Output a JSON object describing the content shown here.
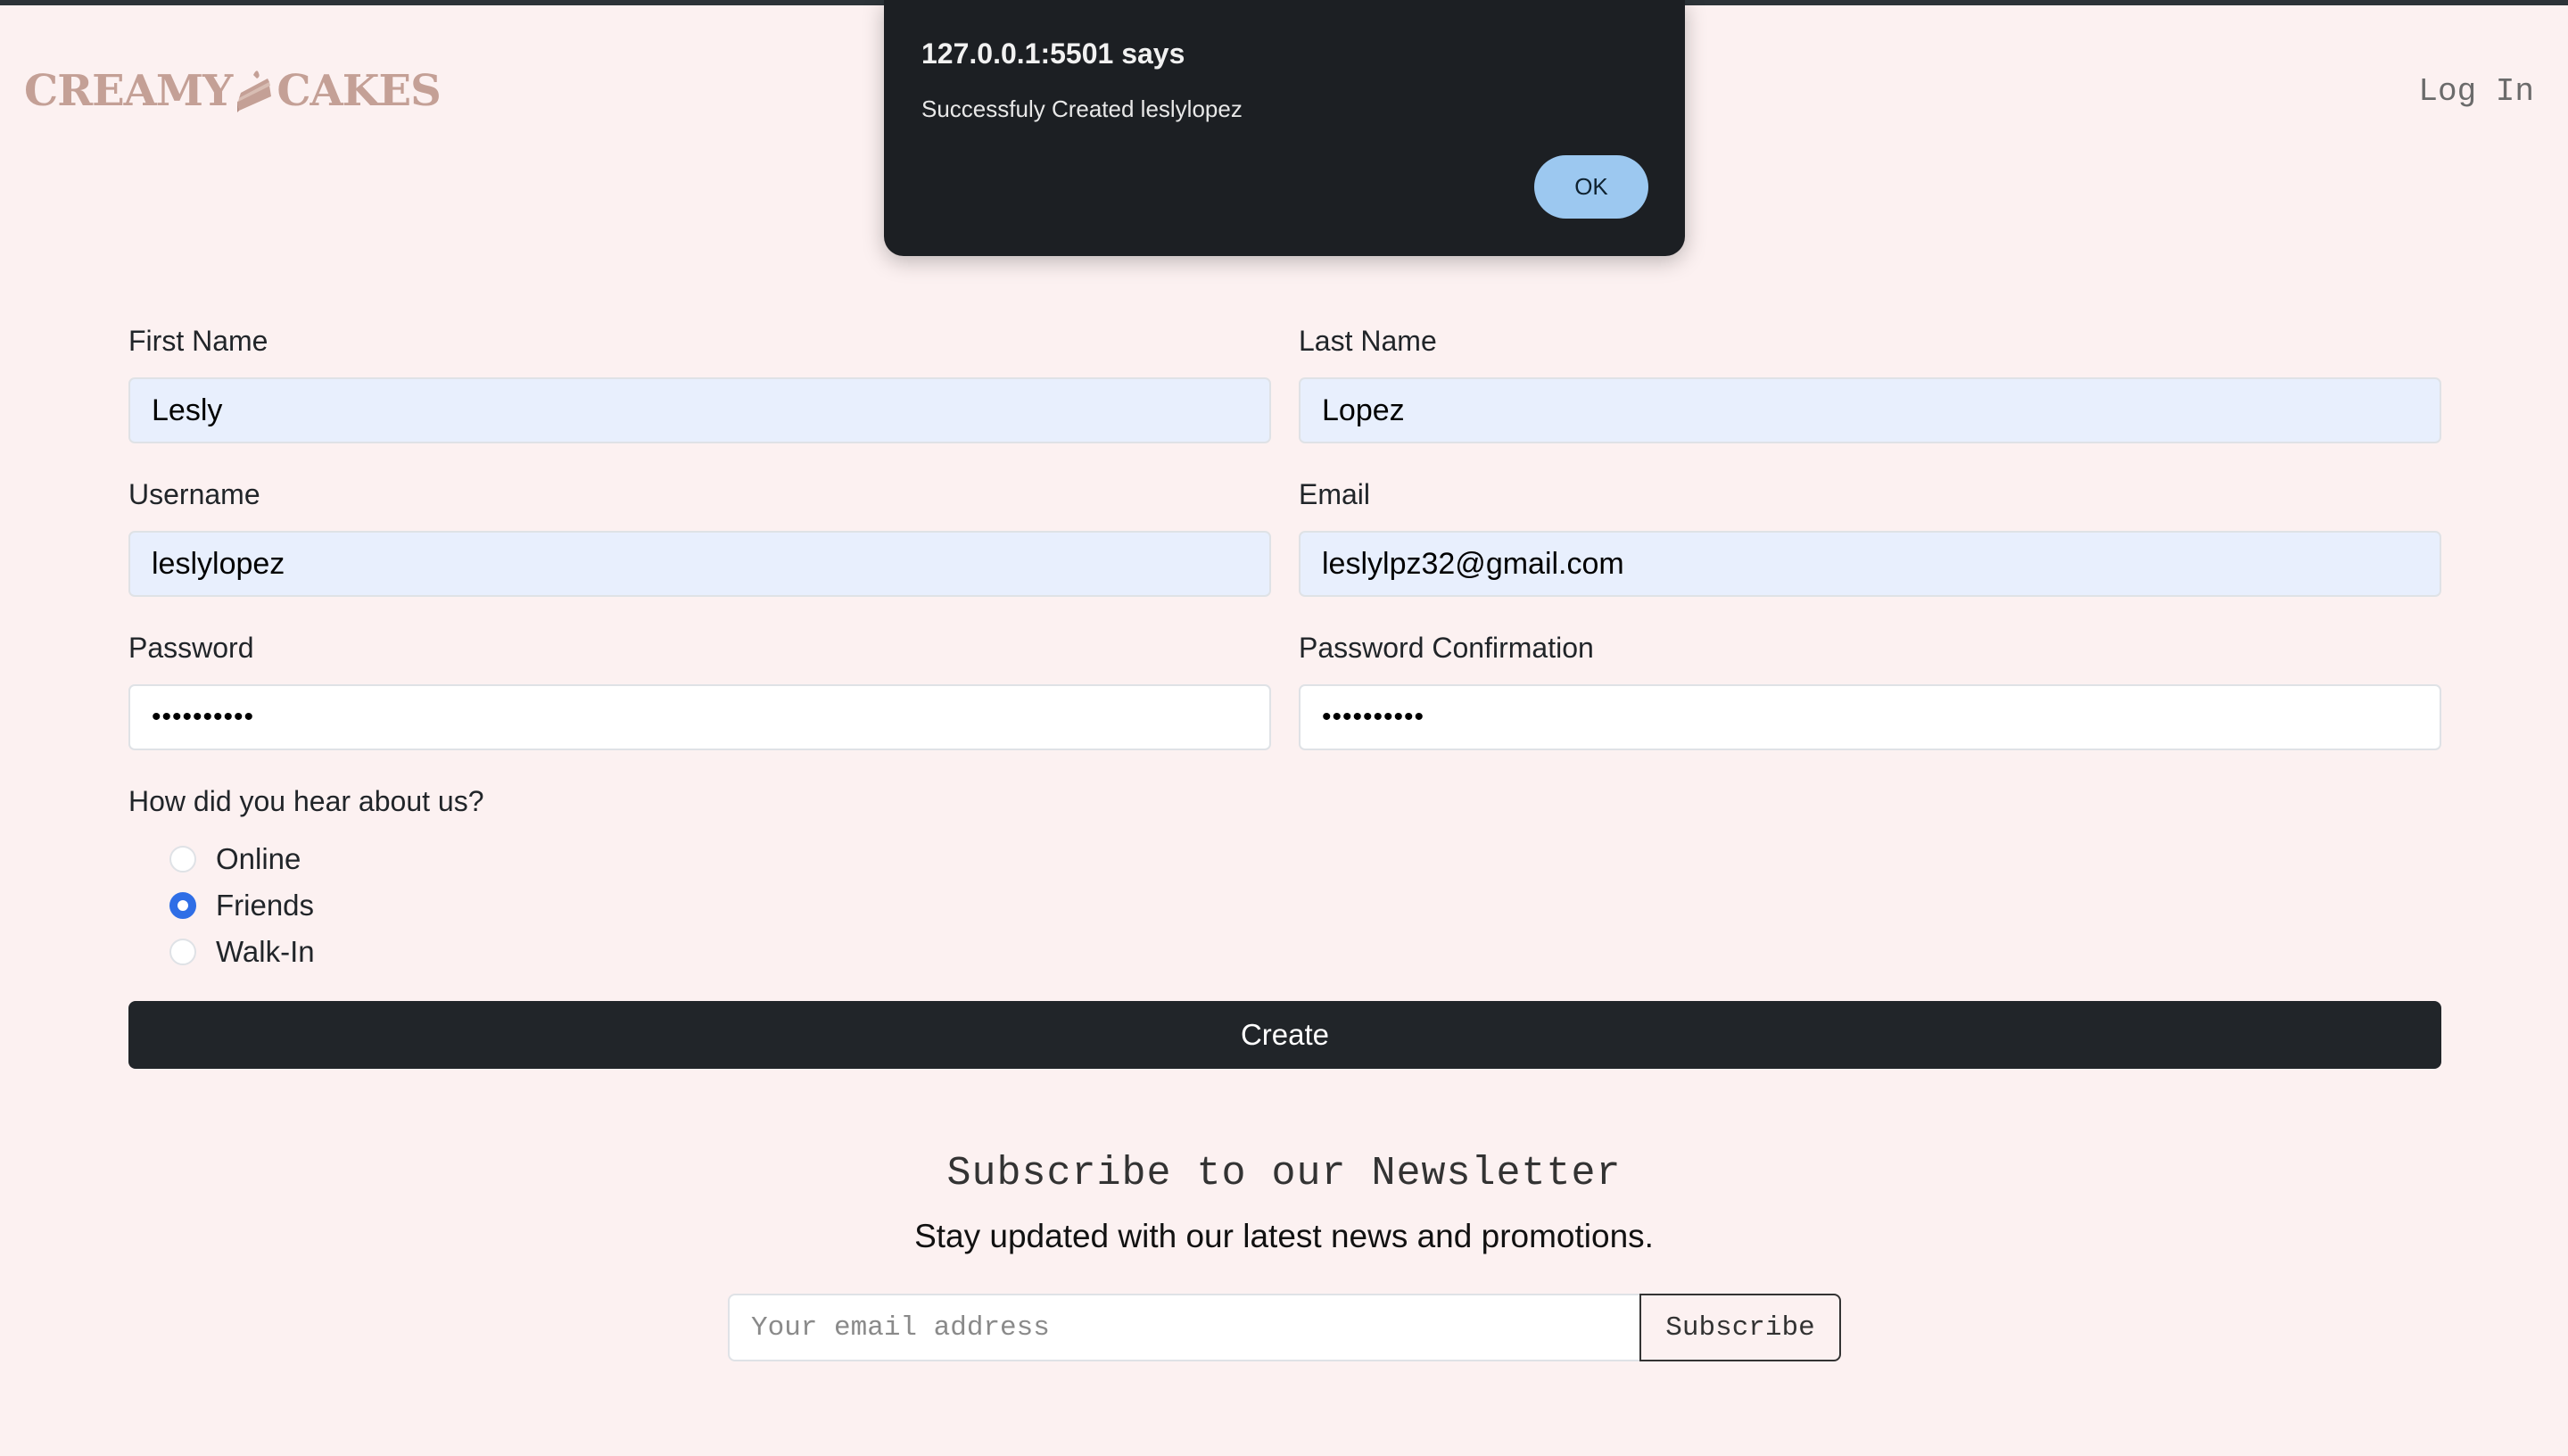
{
  "header": {
    "brand_left": "CREAMY",
    "brand_right": "CAKES",
    "login_label": "Log In"
  },
  "dialog": {
    "title": "127.0.0.1:5501 says",
    "message": "Successfuly Created leslylopez",
    "ok_label": "OK"
  },
  "form": {
    "first_name": {
      "label": "First Name",
      "value": "Lesly"
    },
    "last_name": {
      "label": "Last Name",
      "value": "Lopez"
    },
    "username": {
      "label": "Username",
      "value": "leslylopez"
    },
    "email": {
      "label": "Email",
      "value": "leslylpz32@gmail.com"
    },
    "password": {
      "label": "Password",
      "value": "••••••••••"
    },
    "password_confirmation": {
      "label": "Password Confirmation",
      "value": "••••••••••"
    },
    "referral": {
      "question": "How did you hear about us?",
      "options": [
        {
          "label": "Online",
          "checked": false
        },
        {
          "label": "Friends",
          "checked": true
        },
        {
          "label": "Walk-In",
          "checked": false
        }
      ]
    },
    "submit_label": "Create"
  },
  "newsletter": {
    "title": "Subscribe to our Newsletter",
    "subtitle": "Stay updated with our latest news and promotions.",
    "email_placeholder": "Your email address",
    "button_label": "Subscribe"
  },
  "colors": {
    "page_background": "#fcf1f1",
    "brand": "#c4a096",
    "autofill_field": "#e8effd",
    "radio_checked": "#2f6ee6",
    "create_button": "#212529",
    "dialog_background": "#1c1f23",
    "dialog_ok_button": "#9cc8f0"
  }
}
